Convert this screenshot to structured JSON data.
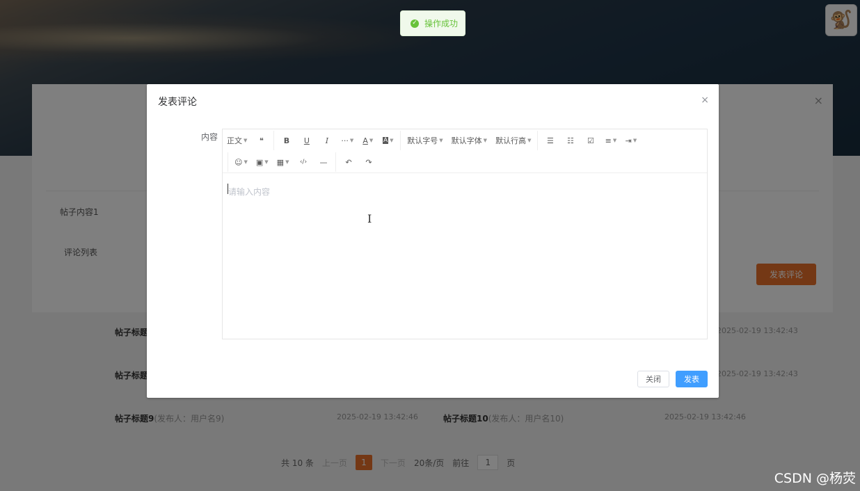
{
  "toast": {
    "text": "操作成功"
  },
  "detail": {
    "content_label": "帖子内容1",
    "comments_label": "评论列表",
    "comment_button": "发表评论",
    "close": "×"
  },
  "posts": [
    {
      "title": "帖子标题",
      "time": "2025-02-19 13:42:43"
    },
    {
      "title": "帖子标题",
      "time": "2025-02-19 13:42:43"
    },
    {
      "title": "帖子标题9",
      "meta": "(发布人：用户名9)",
      "time": "2025-02-19 13:42:46"
    },
    {
      "title": "帖子标题10",
      "meta": "(发布人：用户名10)",
      "time": "2025-02-19 13:42:46"
    }
  ],
  "pager": {
    "total": "共 10 条",
    "prev": "上一页",
    "current": "1",
    "next": "下一页",
    "size": "20条/页",
    "goto": "前往",
    "goto_value": "1",
    "page_suffix": "页"
  },
  "dialog": {
    "title": "发表评论",
    "close": "×",
    "field_label": "内容",
    "placeholder": "请输入内容",
    "close_button": "关闭",
    "submit_button": "发表"
  },
  "toolbar": {
    "paragraph": "正文",
    "quote": "❝",
    "bold": "B",
    "underline": "U",
    "italic": "I",
    "more": "···",
    "font_color": "A",
    "bg_color": "A",
    "font_size": "默认字号",
    "font_family": "默认字体",
    "line_height": "默认行高",
    "bulleted_list": "☰",
    "numbered_list": "☷",
    "todo": "☑",
    "justify": "≡",
    "indent": "⇥",
    "emotion": "☺",
    "image": "▣",
    "table": "▦",
    "code": "‹/›",
    "divider": "—",
    "undo": "↶",
    "redo": "↷"
  },
  "watermark": "CSDN @杨荧"
}
